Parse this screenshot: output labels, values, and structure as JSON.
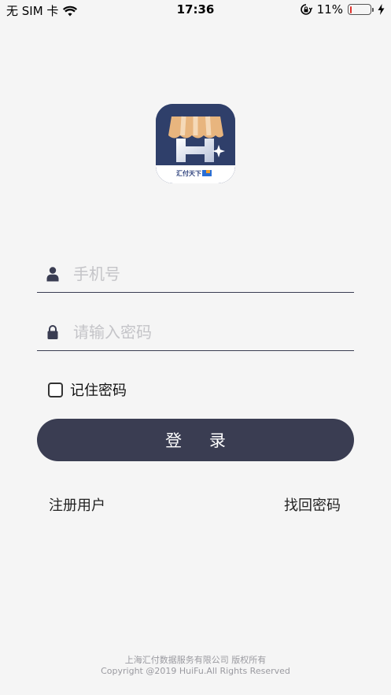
{
  "status_bar": {
    "carrier": "无 SIM 卡",
    "time": "17:36",
    "battery_percent": "11%",
    "battery_level": 0.11
  },
  "logo": {
    "text": "汇付天下"
  },
  "form": {
    "phone_placeholder": "手机号",
    "password_placeholder": "请输入密码",
    "remember_label": "记住密码",
    "login_label": "登 录"
  },
  "links": {
    "register": "注册用户",
    "forgot": "找回密码"
  },
  "footer": {
    "line1": "上海汇付数据服务有限公司 版权所有",
    "line2": "Copyright @2019 HuiFu.All Rights Reserved"
  },
  "colors": {
    "background": "#f5f5f5",
    "primary": "#3a3d52",
    "battery_low": "#e0322c",
    "logo_navy": "#2f3f6a",
    "logo_awning": "#e8b57e"
  },
  "icons": [
    "wifi-icon",
    "rotation-lock-icon",
    "battery-icon",
    "charging-bolt-icon",
    "user-icon",
    "lock-icon",
    "checkbox-icon"
  ]
}
